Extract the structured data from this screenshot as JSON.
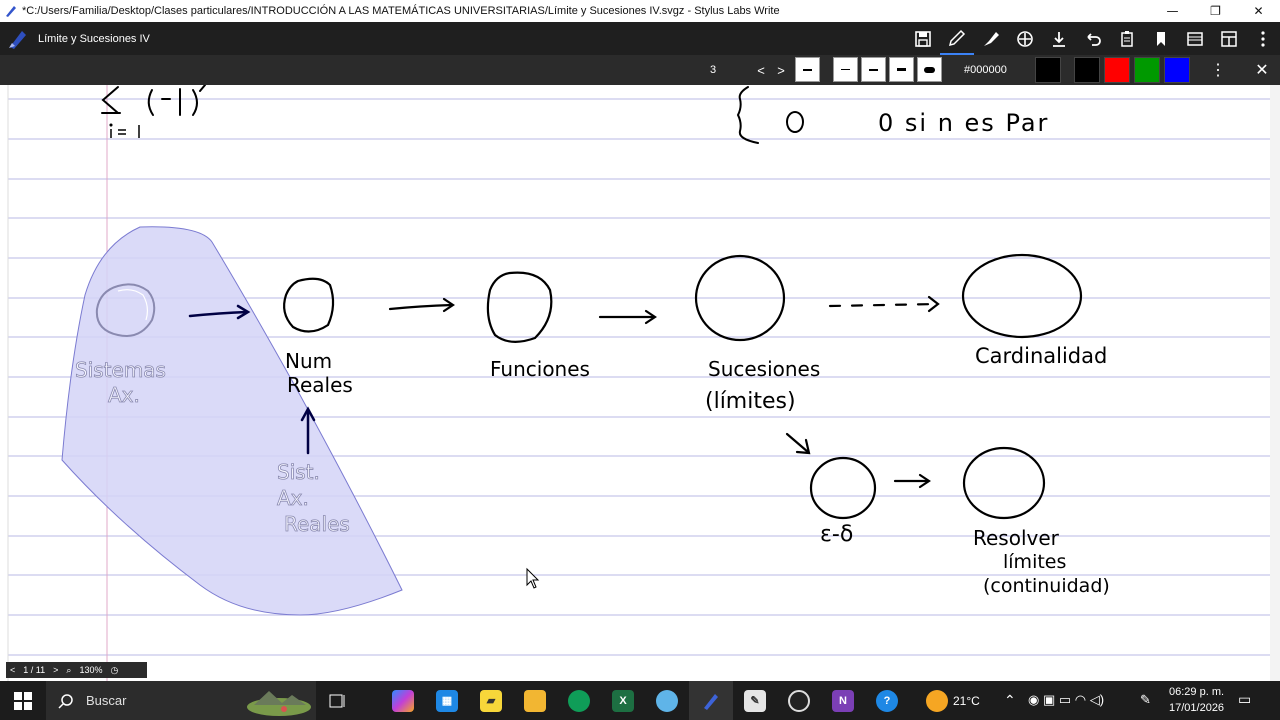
{
  "window": {
    "title": "*C:/Users/Familia/Desktop/Clases particulares/INTRODUCCIÓN A LAS MATEMÁTICAS UNIVERSITARIAS/Límite y Sucesiones IV.svgz - Stylus Labs Write",
    "minimize": "—",
    "restore": "❐",
    "close": "✕"
  },
  "toolbar": {
    "doc_title": "Límite y Sucesiones IV",
    "icons": [
      "save-icon",
      "pen-icon",
      "highlighter-icon",
      "pan-icon",
      "insert-space-icon",
      "undo-icon",
      "clipboard-icon",
      "bookmark-icon",
      "page-setup-icon",
      "layout-icon",
      "more-icon"
    ]
  },
  "pen_toolbar": {
    "size": "3",
    "prev": "<",
    "next": ">",
    "color_hex": "#000000",
    "swatches": [
      "#000000",
      "#000000",
      "#ff0000",
      "#009900",
      "#0000ff"
    ],
    "menu": "⋮",
    "close": "✕"
  },
  "status": {
    "page": "1 / 11",
    "zoom": "130%"
  },
  "notes": {
    "top_math": "Σ(-1)",
    "index": "i=1",
    "brace_text": "0   si   n   es   Par",
    "left_blob_label_1": "Sistemas",
    "left_blob_label_2": "Ax.",
    "num": "Num",
    "reales": "Reales",
    "sist_1": "Sist.",
    "sist_2": "Ax.",
    "sist_3": "Reales",
    "funciones": "Funciones",
    "sucesiones": "Sucesiones",
    "limites": "(límites)",
    "cardinalidad": "Cardinalidad",
    "eps_delta": "ε-δ",
    "resolver": "Resolver",
    "limites2": "límites",
    "continuidad": "(continuidad)"
  },
  "taskbar": {
    "search_placeholder": "Buscar",
    "temperature": "21°C",
    "time": "06:29 p. m.",
    "date": "17/01/2026",
    "apps": [
      "task-view-icon",
      "copilot-icon",
      "calendar-icon",
      "sticky-notes-icon",
      "file-explorer-icon",
      "edge-icon",
      "excel-icon",
      "paint-icon",
      "write-icon",
      "notepad-icon",
      "obs-icon",
      "onenote-icon",
      "help-icon"
    ]
  },
  "colors": {
    "ink": "#000000",
    "highlight_fill": "#d4d4f7",
    "highlight_stroke": "#7b7bd1",
    "rule_line": "#b8b8e6",
    "margin_line": "#e0a8c8"
  }
}
